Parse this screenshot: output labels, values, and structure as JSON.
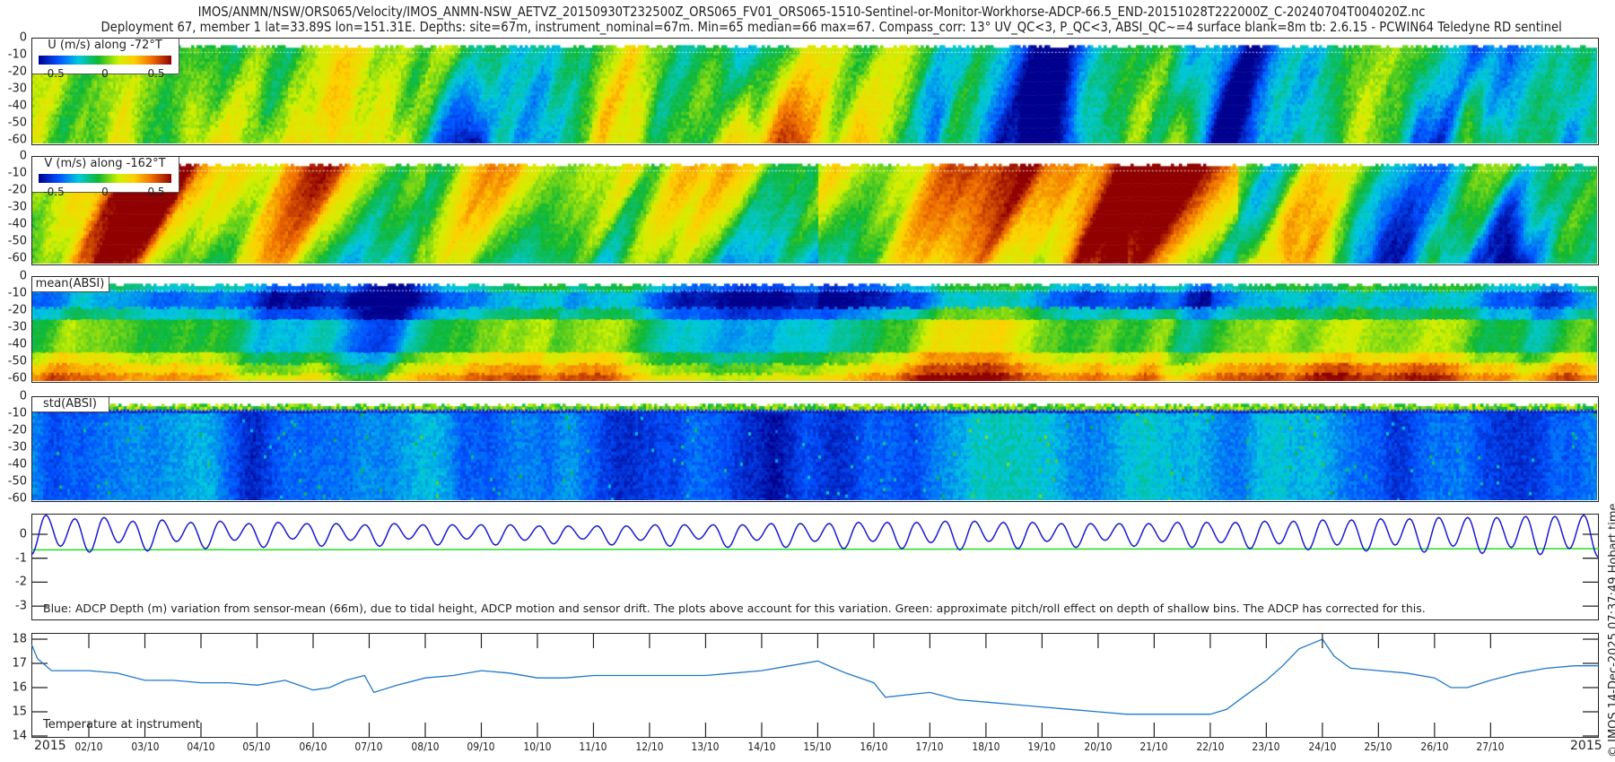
{
  "header": {
    "title_line1": "IMOS/ANMN/NSW/ORS065/Velocity/IMOS_ANMN-NSW_AETVZ_20150930T232500Z_ORS065_FV01_ORS065-1510-Sentinel-or-Monitor-Workhorse-ADCP-66.5_END-20151028T222000Z_C-20240704T004020Z.nc",
    "title_line2": "Deployment 67, member 1 lat=33.89S lon=151.31E. Depths: site=67m, instrument_nominal=67m. Min=65 median=66 max=67. Compass_corr: 13° UV_QC<3, P_QC<3, ABSI_QC~=4 surface blank=8m tb: 2.6.15 - PCWIN64 Teledyne RD sentinel"
  },
  "footer": {
    "side_text": "© IMOS 14-Dec-2025 07:37:49 Hobart time",
    "year_left": "2015",
    "year_right": "2015"
  },
  "colors": {
    "depth_line": "#1a1ad0",
    "pitch_roll_line": "#22dd22",
    "temperature_line": "#1f78c8",
    "colormap": [
      "#00008f",
      "#0050ff",
      "#00c8e0",
      "#10b830",
      "#d0f000",
      "#ffd000",
      "#f07000",
      "#900000"
    ]
  },
  "x_ticks": [
    "02/10",
    "03/10",
    "04/10",
    "05/10",
    "06/10",
    "07/10",
    "08/10",
    "09/10",
    "10/10",
    "11/10",
    "12/10",
    "13/10",
    "14/10",
    "15/10",
    "16/10",
    "17/10",
    "18/10",
    "19/10",
    "20/10",
    "21/10",
    "22/10",
    "23/10",
    "24/10",
    "25/10",
    "26/10",
    "27/10"
  ],
  "chart_data": [
    {
      "type": "heatmap",
      "legend_label": "U (m/s) along -72°T",
      "colorbar_ticks": [
        "-0.5",
        "0",
        "0.5"
      ],
      "colorbar_range": [
        -0.7,
        0.7
      ],
      "y_ticks": [
        "0",
        "-10",
        "-20",
        "-30",
        "-40",
        "-50",
        "-60"
      ],
      "ylim": [
        -63,
        0
      ],
      "xlim": [
        "2015-09-30T23:25",
        "2015-10-28T22:20"
      ]
    },
    {
      "type": "heatmap",
      "legend_label": "V (m/s) along -162°T",
      "colorbar_ticks": [
        "-0.5",
        "0",
        "0.5"
      ],
      "colorbar_range": [
        -0.7,
        0.7
      ],
      "y_ticks": [
        "0",
        "-10",
        "-20",
        "-30",
        "-40",
        "-50",
        "-60"
      ],
      "ylim": [
        -63,
        0
      ],
      "xlim": [
        "2015-09-30T23:25",
        "2015-10-28T22:20"
      ]
    },
    {
      "type": "heatmap",
      "legend_label": "mean(ABSI)",
      "y_ticks": [
        "0",
        "-10",
        "-20",
        "-30",
        "-40",
        "-50",
        "-60"
      ],
      "ylim": [
        -63,
        0
      ],
      "xlim": [
        "2015-09-30T23:25",
        "2015-10-28T22:20"
      ]
    },
    {
      "type": "heatmap",
      "legend_label": "std(ABSI)",
      "y_ticks": [
        "0",
        "-10",
        "-20",
        "-30",
        "-40",
        "-50",
        "-60"
      ],
      "ylim": [
        -63,
        0
      ],
      "xlim": [
        "2015-09-30T23:25",
        "2015-10-28T22:20"
      ]
    },
    {
      "type": "line",
      "annotation": "Blue: ADCP Depth (m) variation from sensor-mean (66m), due to tidal height, ADCP motion and sensor drift. The plots above account for this variation. Green: approximate pitch/roll effect on depth of shallow bins. The ADCP has corrected for this.",
      "y_ticks": [
        "0",
        "-1",
        "-2",
        "-3"
      ],
      "ylim": [
        -3.6,
        0.87
      ],
      "xlim": [
        "2015-09-30T23:25",
        "2015-10-28T22:20"
      ],
      "series": [
        {
          "color": "blue",
          "x_start": "2015-09-30T23:25",
          "extrema_interval_h": 6.21,
          "extrema": [
            -0.85,
            0.8,
            -0.5,
            0.65,
            -0.75,
            0.7,
            -0.35,
            0.55,
            -0.7,
            0.6,
            -0.3,
            0.5,
            -0.6,
            0.55,
            -0.25,
            0.45,
            -0.55,
            0.5,
            -0.2,
            0.45,
            -0.5,
            0.45,
            -0.25,
            0.4,
            -0.5,
            0.45,
            -0.2,
            0.4,
            -0.45,
            0.4,
            -0.2,
            0.4,
            -0.45,
            0.4,
            -0.25,
            0.35,
            -0.4,
            0.35,
            -0.2,
            0.35,
            -0.45,
            0.35,
            -0.25,
            0.4,
            -0.5,
            0.4,
            -0.2,
            0.4,
            -0.55,
            0.4,
            -0.25,
            0.45,
            -0.55,
            0.45,
            -0.3,
            0.45,
            -0.6,
            0.5,
            -0.3,
            0.5,
            -0.6,
            0.5,
            -0.35,
            0.55,
            -0.65,
            0.55,
            -0.3,
            0.5,
            -0.6,
            0.5,
            -0.3,
            0.45,
            -0.55,
            0.45,
            -0.25,
            0.45,
            -0.5,
            0.45,
            -0.3,
            0.5,
            -0.55,
            0.5,
            -0.35,
            0.5,
            -0.6,
            0.55,
            -0.4,
            0.55,
            -0.65,
            0.6,
            -0.45,
            0.6,
            -0.7,
            0.65,
            -0.45,
            0.65,
            -0.75,
            0.7,
            -0.5,
            0.7,
            -0.8,
            0.7,
            -0.55,
            0.75,
            -0.85,
            0.75,
            -0.6,
            0.8,
            -0.95,
            0.75,
            -0.55,
            0.7,
            -0.75
          ]
        },
        {
          "color": "green",
          "x": [
            "2015-09-30T23:25",
            "2015-10-28T22:20"
          ],
          "y": [
            -0.65,
            -0.6
          ]
        }
      ]
    },
    {
      "type": "line",
      "annotation": "Temperature at instrument",
      "y_ticks": [
        "14",
        "15",
        "16",
        "17",
        "18"
      ],
      "ylim": [
        14,
        18.26
      ],
      "xlim": [
        "2015-09-30T23:25",
        "2015-10-28T22:20"
      ],
      "x": [
        "2015-09-30T23:25",
        "2015-10-01T02:00",
        "2015-10-01T08:00",
        "2015-10-02T00:00",
        "2015-10-02T12:00",
        "2015-10-03T00:00",
        "2015-10-03T12:00",
        "2015-10-04T00:00",
        "2015-10-04T12:00",
        "2015-10-05T00:00",
        "2015-10-05T12:00",
        "2015-10-06T00:00",
        "2015-10-06T07:00",
        "2015-10-06T14:00",
        "2015-10-06T22:00",
        "2015-10-07T02:00",
        "2015-10-07T12:00",
        "2015-10-08T00:00",
        "2015-10-08T12:00",
        "2015-10-09T00:00",
        "2015-10-09T12:00",
        "2015-10-10T00:00",
        "2015-10-10T12:00",
        "2015-10-11T00:00",
        "2015-10-11T12:00",
        "2015-10-12T00:00",
        "2015-10-12T12:00",
        "2015-10-13T00:00",
        "2015-10-13T12:00",
        "2015-10-14T00:00",
        "2015-10-14T12:00",
        "2015-10-15T00:00",
        "2015-10-15T07:00",
        "2015-10-15T12:00",
        "2015-10-16T00:00",
        "2015-10-16T05:00",
        "2015-10-16T14:00",
        "2015-10-17T00:00",
        "2015-10-17T12:00",
        "2015-10-18T00:00",
        "2015-10-18T12:00",
        "2015-10-19T00:00",
        "2015-10-19T12:00",
        "2015-10-20T00:00",
        "2015-10-20T12:00",
        "2015-10-21T00:00",
        "2015-10-21T12:00",
        "2015-10-22T00:00",
        "2015-10-22T07:00",
        "2015-10-22T14:00",
        "2015-10-23T00:00",
        "2015-10-23T07:00",
        "2015-10-23T14:00",
        "2015-10-24T00:00",
        "2015-10-24T05:00",
        "2015-10-24T12:00",
        "2015-10-25T00:00",
        "2015-10-25T12:00",
        "2015-10-26T00:00",
        "2015-10-26T07:00",
        "2015-10-26T14:00",
        "2015-10-27T00:00",
        "2015-10-27T12:00",
        "2015-10-28T00:00",
        "2015-10-28T12:00",
        "2015-10-28T22:20"
      ],
      "y": [
        17.8,
        17.2,
        16.7,
        16.7,
        16.6,
        16.3,
        16.3,
        16.2,
        16.2,
        16.1,
        16.3,
        15.9,
        16.0,
        16.3,
        16.5,
        15.8,
        16.1,
        16.4,
        16.5,
        16.7,
        16.6,
        16.4,
        16.4,
        16.5,
        16.5,
        16.5,
        16.5,
        16.5,
        16.6,
        16.7,
        16.9,
        17.1,
        16.8,
        16.6,
        16.2,
        15.6,
        15.7,
        15.8,
        15.5,
        15.4,
        15.3,
        15.2,
        15.1,
        15.0,
        14.9,
        14.9,
        14.9,
        14.9,
        15.1,
        15.6,
        16.3,
        16.9,
        17.6,
        18.0,
        17.3,
        16.8,
        16.7,
        16.6,
        16.4,
        16.0,
        16.0,
        16.3,
        16.6,
        16.8,
        16.9,
        16.9
      ]
    }
  ]
}
